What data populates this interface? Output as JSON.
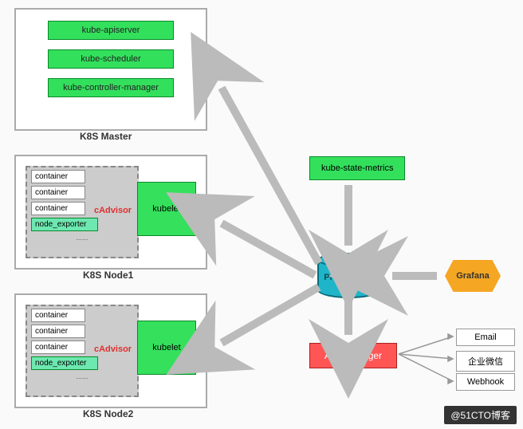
{
  "master": {
    "title": "K8S Master",
    "items": [
      "kube-apiserver",
      "kube-scheduler",
      "kube-controller-manager"
    ]
  },
  "node1": {
    "title": "K8S Node1",
    "containers": [
      "container",
      "container",
      "container"
    ],
    "exporter": "node_exporter",
    "cadvisor": "cAdvisor",
    "kubelet": "kubelet"
  },
  "node2": {
    "title": "K8S Node2",
    "containers": [
      "container",
      "container",
      "container"
    ],
    "exporter": "node_exporter",
    "cadvisor": "cAdvisor",
    "kubelet": "kubelet"
  },
  "ksm": "kube-state-metrics",
  "prom": "Prometheus",
  "grafana": "Grafana",
  "alert": "Alertmanager",
  "outputs": [
    "Email",
    "企业微信",
    "Webhook"
  ],
  "watermark": "@51CTO博客"
}
